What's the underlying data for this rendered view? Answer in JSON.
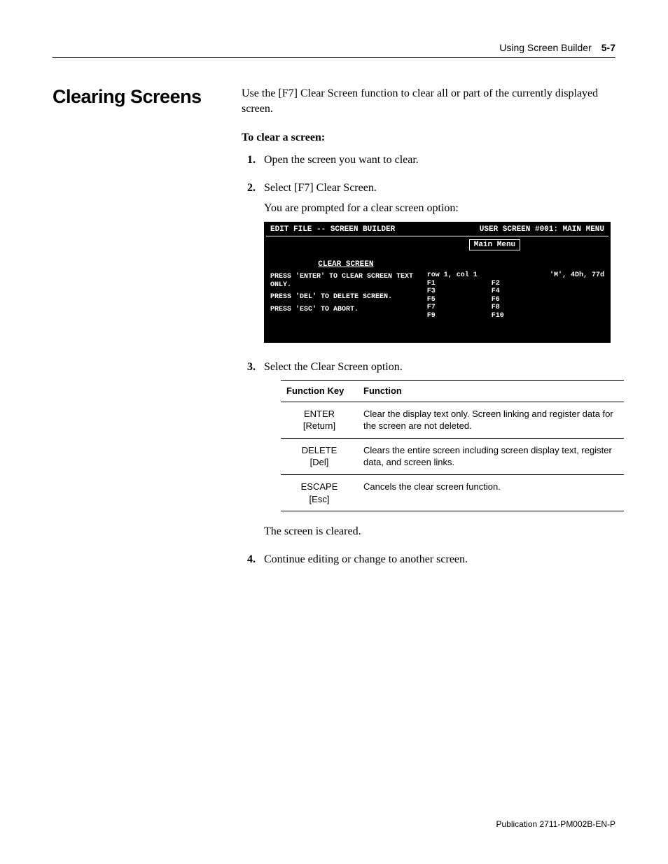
{
  "header": {
    "chapter": "Using Screen Builder",
    "page": "5-7"
  },
  "title": "Clearing Screens",
  "intro": "Use the [F7] Clear Screen function to clear all or part of the currently displayed screen.",
  "procedure_heading": "To clear a screen:",
  "steps": {
    "s1": "Open the screen you want to clear.",
    "s2": "Select [F7] Clear Screen.",
    "s2b": "You are prompted for a clear screen option:",
    "s3": "Select the Clear Screen option.",
    "after_table": "The screen is cleared.",
    "s4": "Continue editing or change to another screen."
  },
  "terminal": {
    "title_left": "EDIT FILE -- SCREEN BUILDER",
    "title_right": "USER SCREEN #001: MAIN MENU",
    "cs_head": "CLEAR SCREEN",
    "cs_l1": "PRESS 'ENTER' TO CLEAR SCREEN TEXT ONLY.",
    "cs_l2": "PRESS 'DEL' TO DELETE SCREEN.",
    "cs_l3": "PRESS 'ESC' TO ABORT.",
    "mm": "Main Menu",
    "info_left": "row  1, col  1",
    "info_right": "'M', 4Dh,  77d",
    "fleft": {
      "a": "F1",
      "b": "F3",
      "c": "F5",
      "d": "F7",
      "e": "F9"
    },
    "fright": {
      "a": "F2",
      "b": "F4",
      "c": "F6",
      "d": "F8",
      "e": "F10"
    }
  },
  "table": {
    "h1": "Function Key",
    "h2": "Function",
    "r1k": "ENTER\n[Return]",
    "r1v": "Clear the display text only.  Screen linking  and register data for the screen are not deleted.",
    "r2k": "DELETE\n[Del]",
    "r2v": "Clears the entire screen including screen display text, register data, and screen links.",
    "r3k": "ESCAPE\n[Esc]",
    "r3v": "Cancels the clear screen function."
  },
  "footer": "Publication 2711-PM002B-EN-P"
}
